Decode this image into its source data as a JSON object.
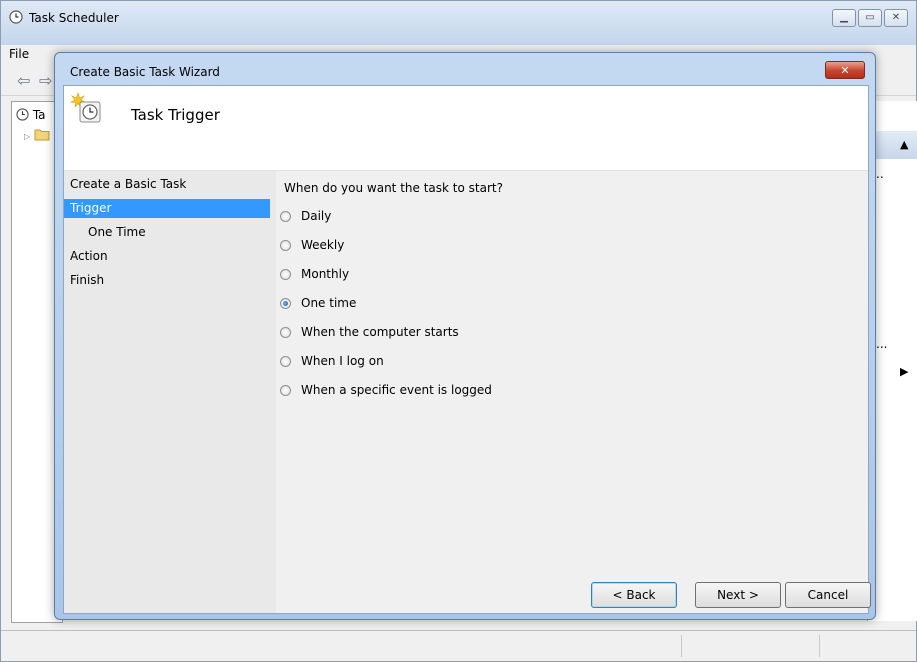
{
  "main_window": {
    "title": "Task Scheduler",
    "menu": [
      "File"
    ],
    "tree_items": [
      "Ta"
    ],
    "right_ellipsis_1": "..",
    "right_ellipsis_2": "..."
  },
  "dialog": {
    "title": "Create Basic Task Wizard",
    "header_title": "Task Trigger",
    "steps": [
      {
        "label": "Create a Basic Task",
        "selected": false,
        "indent": false
      },
      {
        "label": "Trigger",
        "selected": true,
        "indent": false
      },
      {
        "label": "One Time",
        "selected": false,
        "indent": true
      },
      {
        "label": "Action",
        "selected": false,
        "indent": false
      },
      {
        "label": "Finish",
        "selected": false,
        "indent": false
      }
    ],
    "question": "When do you want the task to start?",
    "options": [
      {
        "label": "Daily",
        "checked": false
      },
      {
        "label": "Weekly",
        "checked": false
      },
      {
        "label": "Monthly",
        "checked": false
      },
      {
        "label": "One time",
        "checked": true
      },
      {
        "label": "When the computer starts",
        "checked": false
      },
      {
        "label": "When I log on",
        "checked": false
      },
      {
        "label": "When a specific event is logged",
        "checked": false
      }
    ],
    "buttons": {
      "back": "< Back",
      "next": "Next >",
      "cancel": "Cancel"
    }
  },
  "colors": {
    "selection": "#3399ff",
    "dialog_frame": "#a9c6e8",
    "close_button": "#c7432c"
  }
}
